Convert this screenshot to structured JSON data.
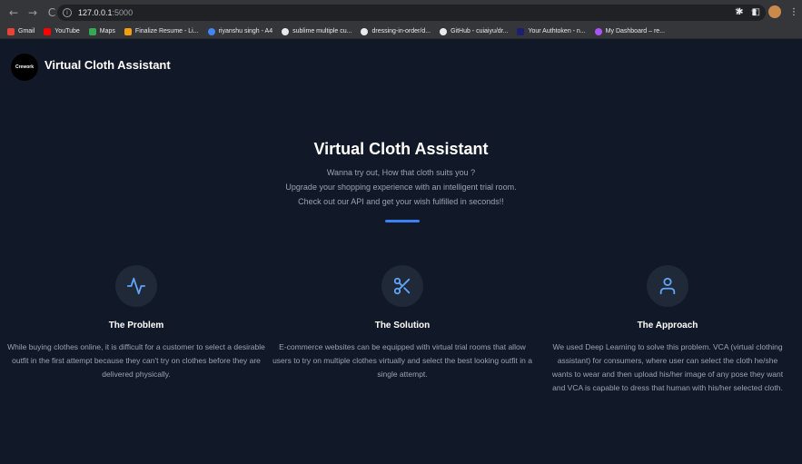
{
  "browser": {
    "url_host": "127.0.0.1",
    "url_port": ":5000",
    "bookmarks": [
      {
        "label": "Gmail",
        "color": "#ea4335"
      },
      {
        "label": "YouTube",
        "color": "#ff0000"
      },
      {
        "label": "Maps",
        "color": "#34a853"
      },
      {
        "label": "Finalize Resume - Li...",
        "color": "#f59e0b"
      },
      {
        "label": "riyanshu singh - A4",
        "color": "#4285f4"
      },
      {
        "label": "sublime multiple cu...",
        "color": "#e8eaed"
      },
      {
        "label": "dressing-in-order/d...",
        "color": "#e8eaed"
      },
      {
        "label": "GitHub - cuiaiyu/dr...",
        "color": "#e8eaed"
      },
      {
        "label": "Your Authtoken - n...",
        "color": "#1a1f71"
      },
      {
        "label": "My Dashboard – re...",
        "color": "#a855f7"
      }
    ]
  },
  "header": {
    "logo_text": "Crework",
    "title": "Virtual Cloth Assistant"
  },
  "hero": {
    "title": "Virtual Cloth Assistant",
    "line1": "Wanna try out, How that cloth suits you ?",
    "line2": "Upgrade your shopping experience with an intelligent trial room.",
    "line3": "Check out our API and get your wish fulfilled in seconds!!",
    "accent": "#3b82f6"
  },
  "features": [
    {
      "icon": "activity-icon",
      "title": "The Problem",
      "text": "While buying clothes online, it is difficult for a customer to select a desirable outfit in the first attempt because they can't try on clothes before they are delivered physically."
    },
    {
      "icon": "scissors-icon",
      "title": "The Solution",
      "text": "E-commerce websites can be equipped with virtual trial rooms that allow users to try on multiple clothes virtually and select the best looking outfit in a single attempt."
    },
    {
      "icon": "user-icon",
      "title": "The Approach",
      "text": "We used Deep Learning to solve this problem. VCA (virtual clothing assistant) for consumers, where user can select the cloth he/she wants to wear and then upload his/her image of any pose they want and VCA is capable to dress that human with his/her selected cloth."
    }
  ]
}
